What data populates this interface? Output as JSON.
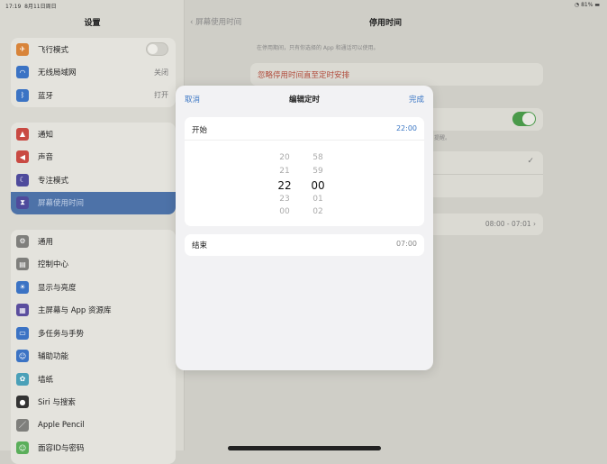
{
  "status": {
    "time": "17:19",
    "date": "8月11日周日",
    "battery": "81%"
  },
  "sidebar": {
    "title": "设置",
    "groups": [
      [
        {
          "label": "飞行模式",
          "icon": "airplane-icon",
          "color": "#d8843a",
          "toggle": true
        },
        {
          "label": "无线局域网",
          "icon": "wifi-icon",
          "color": "#3b73c4",
          "value": "关闭"
        },
        {
          "label": "蓝牙",
          "icon": "bluetooth-icon",
          "color": "#3b73c4",
          "value": "打开"
        }
      ],
      [
        {
          "label": "通知",
          "icon": "bell-icon",
          "color": "#c94a43"
        },
        {
          "label": "声音",
          "icon": "speaker-icon",
          "color": "#c94a43"
        },
        {
          "label": "专注模式",
          "icon": "moon-icon",
          "color": "#4f4b9c"
        },
        {
          "label": "屏幕使用时间",
          "icon": "hourglass-icon",
          "color": "#4f4b9c",
          "selected": true
        }
      ],
      [
        {
          "label": "通用",
          "icon": "gear-icon",
          "color": "#7f7f7c"
        },
        {
          "label": "控制中心",
          "icon": "switches-icon",
          "color": "#7f7f7c"
        },
        {
          "label": "显示与亮度",
          "icon": "sun-icon",
          "color": "#3b73c4"
        },
        {
          "label": "主屏幕与 App 资源库",
          "icon": "grid-icon",
          "color": "#5b4e9e"
        },
        {
          "label": "多任务与手势",
          "icon": "multitask-icon",
          "color": "#3b73c4"
        },
        {
          "label": "辅助功能",
          "icon": "accessibility-icon",
          "color": "#3b73c4"
        },
        {
          "label": "墙纸",
          "icon": "flower-icon",
          "color": "#4aa0b8"
        },
        {
          "label": "Siri 与搜索",
          "icon": "siri-icon",
          "color": "#333"
        },
        {
          "label": "Apple Pencil",
          "icon": "pencil-icon",
          "color": "#7f7f7c"
        },
        {
          "label": "面容ID与密码",
          "icon": "faceid-icon",
          "color": "#5aae5a"
        }
      ]
    ]
  },
  "main": {
    "back": "屏幕使用时间",
    "title": "停用时间",
    "description": "在停用期间，只有你选择的 App 和通话可以使用。",
    "ignore": "忽略停用时间直至定时安排",
    "note": "提醒。",
    "schedule": "08:00 - 07:01"
  },
  "modal": {
    "cancel": "取消",
    "title": "编辑定时",
    "done": "完成",
    "start_label": "开始",
    "start_value": "22:00",
    "end_label": "结束",
    "end_value": "07:00",
    "hours": [
      "20",
      "21",
      "22",
      "23",
      "00"
    ],
    "minutes": [
      "58",
      "59",
      "00",
      "01",
      "02"
    ]
  },
  "colors": {
    "accent": "#3a76c4",
    "red": "#c0392b",
    "green": "#4aa14a"
  }
}
